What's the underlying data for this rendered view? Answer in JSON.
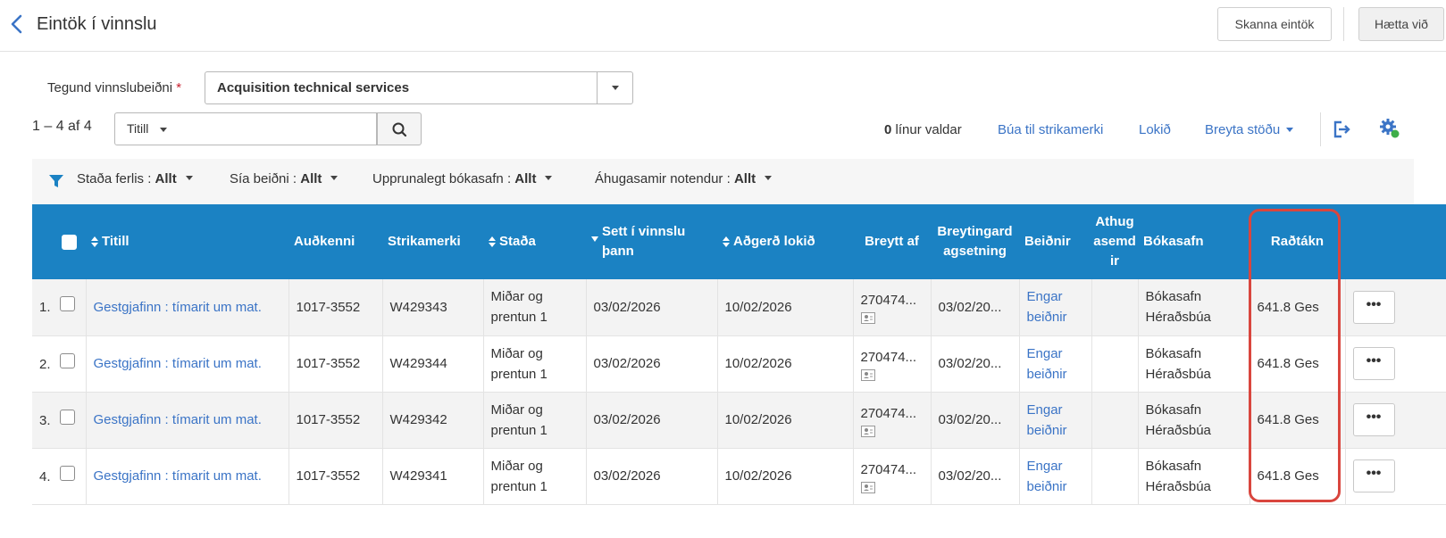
{
  "header": {
    "title": "Eintök í vinnslu",
    "scan_label": "Skanna eintök",
    "cancel_label": "Hætta við"
  },
  "request_type": {
    "label": "Tegund vinnslubeiðni",
    "required_mark": "*",
    "selected": "Acquisition technical services"
  },
  "toolbar": {
    "range": "1 – 4 af 4",
    "search_scope": "Titill",
    "search_value": "",
    "selected_count": "0",
    "selected_suffix": "línur valdar",
    "create_barcodes": "Búa til strikamerki",
    "done": "Lokið",
    "change_status": "Breyta stöðu"
  },
  "filters": [
    {
      "label": "Staða ferlis :",
      "value": "Allt"
    },
    {
      "label": "Sía beiðni :",
      "value": "Allt"
    },
    {
      "label": "Upprunalegt bókasafn :",
      "value": "Allt"
    },
    {
      "label": "Áhugasamir notendur :",
      "value": "Allt"
    }
  ],
  "columns": {
    "title": "Titill",
    "id": "Auðkenni",
    "barcode": "Strikamerki",
    "status": "Staða",
    "processed_since": "Sett í vinnslu þann",
    "action_done": "Aðgerð lokið",
    "modified_by": "Breytt af",
    "modification_date": "Breytingardagsetning",
    "requests": "Beiðnir",
    "notes": "Athugasemdir",
    "library": "Bókasafn",
    "call_number": "Raðtákn"
  },
  "rows": [
    {
      "num": "1.",
      "title": "Gestgjafinn : tímarit um mat.",
      "id": "1017-3552",
      "barcode": "W429343",
      "status": "Miðar og prentun 1",
      "processed_since": "03/02/2026",
      "action_done": "10/02/2026",
      "modified_by": "270474...",
      "modification_date": "03/02/20...",
      "requests": "Engar beiðnir",
      "notes": "",
      "library": "Bókasafn Héraðsbúa",
      "call_number": "641.8 Ges",
      "more": "•••"
    },
    {
      "num": "2.",
      "title": "Gestgjafinn : tímarit um mat.",
      "id": "1017-3552",
      "barcode": "W429344",
      "status": "Miðar og prentun 1",
      "processed_since": "03/02/2026",
      "action_done": "10/02/2026",
      "modified_by": "270474...",
      "modification_date": "03/02/20...",
      "requests": "Engar beiðnir",
      "notes": "",
      "library": "Bókasafn Héraðsbúa",
      "call_number": "641.8 Ges",
      "more": "•••"
    },
    {
      "num": "3.",
      "title": "Gestgjafinn : tímarit um mat.",
      "id": "1017-3552",
      "barcode": "W429342",
      "status": "Miðar og prentun 1",
      "processed_since": "03/02/2026",
      "action_done": "10/02/2026",
      "modified_by": "270474...",
      "modification_date": "03/02/20...",
      "requests": "Engar beiðnir",
      "notes": "",
      "library": "Bókasafn Héraðsbúa",
      "call_number": "641.8 Ges",
      "more": "•••"
    },
    {
      "num": "4.",
      "title": "Gestgjafinn : tímarit um mat.",
      "id": "1017-3552",
      "barcode": "W429341",
      "status": "Miðar og prentun 1",
      "processed_since": "03/02/2026",
      "action_done": "10/02/2026",
      "modified_by": "270474...",
      "modification_date": "03/02/20...",
      "requests": "Engar beiðnir",
      "notes": "",
      "library": "Bókasafn Héraðsbúa",
      "call_number": "641.8 Ges",
      "more": "•••"
    }
  ],
  "colors": {
    "header_blue": "#1b82c3",
    "link_blue": "#3b74c6",
    "highlight_red": "#d9463e",
    "required_red": "#c8202f",
    "gear_badge_green": "#3fae49"
  }
}
